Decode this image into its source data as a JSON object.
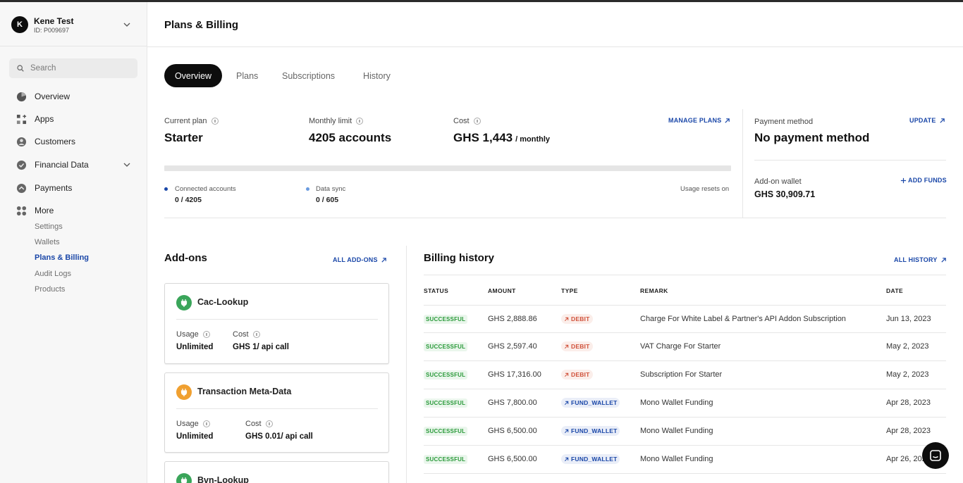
{
  "colors": {
    "accent": "#1a47a8",
    "success": "#2a9a3a",
    "debit": "#d0513a",
    "dark": "#0d0d0d",
    "addon_green": "#3aa55a",
    "addon_orange": "#f0a030"
  },
  "account": {
    "initial": "K",
    "name": "Kene Test",
    "id": "ID: P009697"
  },
  "search": {
    "placeholder": "Search"
  },
  "sidebar": {
    "items": [
      {
        "label": "Overview",
        "icon": "pie-chart-icon"
      },
      {
        "label": "Apps",
        "icon": "apps-icon"
      },
      {
        "label": "Customers",
        "icon": "user-circle-icon"
      },
      {
        "label": "Financial Data",
        "icon": "check-circle-icon"
      },
      {
        "label": "Payments",
        "icon": "payments-icon"
      },
      {
        "label": "More",
        "icon": "grid-icon"
      }
    ],
    "more_items": [
      {
        "label": "Settings"
      },
      {
        "label": "Wallets"
      },
      {
        "label": "Plans & Billing",
        "active": true
      },
      {
        "label": "Audit Logs"
      },
      {
        "label": "Products"
      }
    ]
  },
  "header": {
    "title": "Plans & Billing"
  },
  "tabs": [
    {
      "label": "Overview",
      "active": true
    },
    {
      "label": "Plans"
    },
    {
      "label": "Subscriptions"
    },
    {
      "label": "History"
    }
  ],
  "plan": {
    "current_plan_label": "Current plan",
    "current_plan": "Starter",
    "monthly_limit_label": "Monthly limit",
    "monthly_limit": "4205 accounts",
    "cost_label": "Cost",
    "cost": "GHS 1,443",
    "cost_period": "/ monthly",
    "manage_link": "MANAGE PLANS",
    "usage_fraction": 0,
    "connected_label": "Connected accounts",
    "connected_value": "0 / 4205",
    "sync_label": "Data sync",
    "sync_value": "0 / 605",
    "resets_label": "Usage resets on"
  },
  "payment": {
    "method_label": "Payment method",
    "method_value": "No payment method",
    "update_link": "UPDATE",
    "wallet_label": "Add-on wallet",
    "wallet_value": "GHS 30,909.71",
    "add_funds_link": "ADD FUNDS"
  },
  "addons": {
    "title": "Add-ons",
    "all_link": "ALL ADD-ONS",
    "usage_label": "Usage",
    "cost_label": "Cost",
    "items": [
      {
        "name": "Cac-Lookup",
        "usage": "Unlimited",
        "cost": "GHS 1/ api call"
      },
      {
        "name": "Transaction Meta-Data",
        "usage": "Unlimited",
        "cost": "GHS 0.01/ api call"
      },
      {
        "name": "Bvn-Lookup"
      }
    ]
  },
  "billing": {
    "title": "Billing history",
    "all_link": "ALL HISTORY",
    "columns": [
      "STATUS",
      "AMOUNT",
      "TYPE",
      "REMARK",
      "DATE"
    ],
    "rows": [
      {
        "status": "SUCCESSFUL",
        "amount": "GHS 2,888.86",
        "type": "DEBIT",
        "remark": "Charge For White Label & Partner's API Addon Subscription",
        "date": "Jun 13, 2023"
      },
      {
        "status": "SUCCESSFUL",
        "amount": "GHS 2,597.40",
        "type": "DEBIT",
        "remark": "VAT Charge For Starter",
        "date": "May 2, 2023"
      },
      {
        "status": "SUCCESSFUL",
        "amount": "GHS 17,316.00",
        "type": "DEBIT",
        "remark": "Subscription For Starter",
        "date": "May 2, 2023"
      },
      {
        "status": "SUCCESSFUL",
        "amount": "GHS 7,800.00",
        "type": "FUND_WALLET",
        "remark": "Mono Wallet Funding",
        "date": "Apr 28, 2023"
      },
      {
        "status": "SUCCESSFUL",
        "amount": "GHS 6,500.00",
        "type": "FUND_WALLET",
        "remark": "Mono Wallet Funding",
        "date": "Apr 28, 2023"
      },
      {
        "status": "SUCCESSFUL",
        "amount": "GHS 6,500.00",
        "type": "FUND_WALLET",
        "remark": "Mono Wallet Funding",
        "date": "Apr 26, 2023"
      }
    ]
  }
}
